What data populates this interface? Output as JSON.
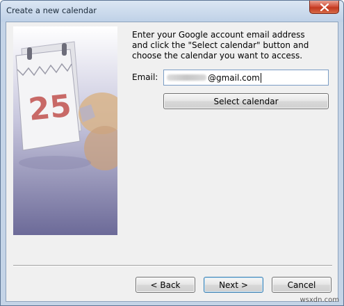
{
  "window": {
    "title": "Create a new calendar"
  },
  "art": {
    "calendar_day": "25"
  },
  "main": {
    "instructions": "Enter your Google account email address\nand click the \"Select calendar\" button and\nchoose the calendar you want to access.",
    "email_label": "Email:",
    "email_value_visible": "@gmail.com",
    "select_calendar_label": "Select calendar"
  },
  "footer": {
    "back_label": "< Back",
    "next_label": "Next >",
    "cancel_label": "Cancel"
  },
  "watermark": "wsxdn.com",
  "icons": {
    "close": "close-icon"
  },
  "colors": {
    "close_button": "#c8412a",
    "art_gradient_bottom": "#6c6a98",
    "calendar_number": "#c0504d"
  }
}
